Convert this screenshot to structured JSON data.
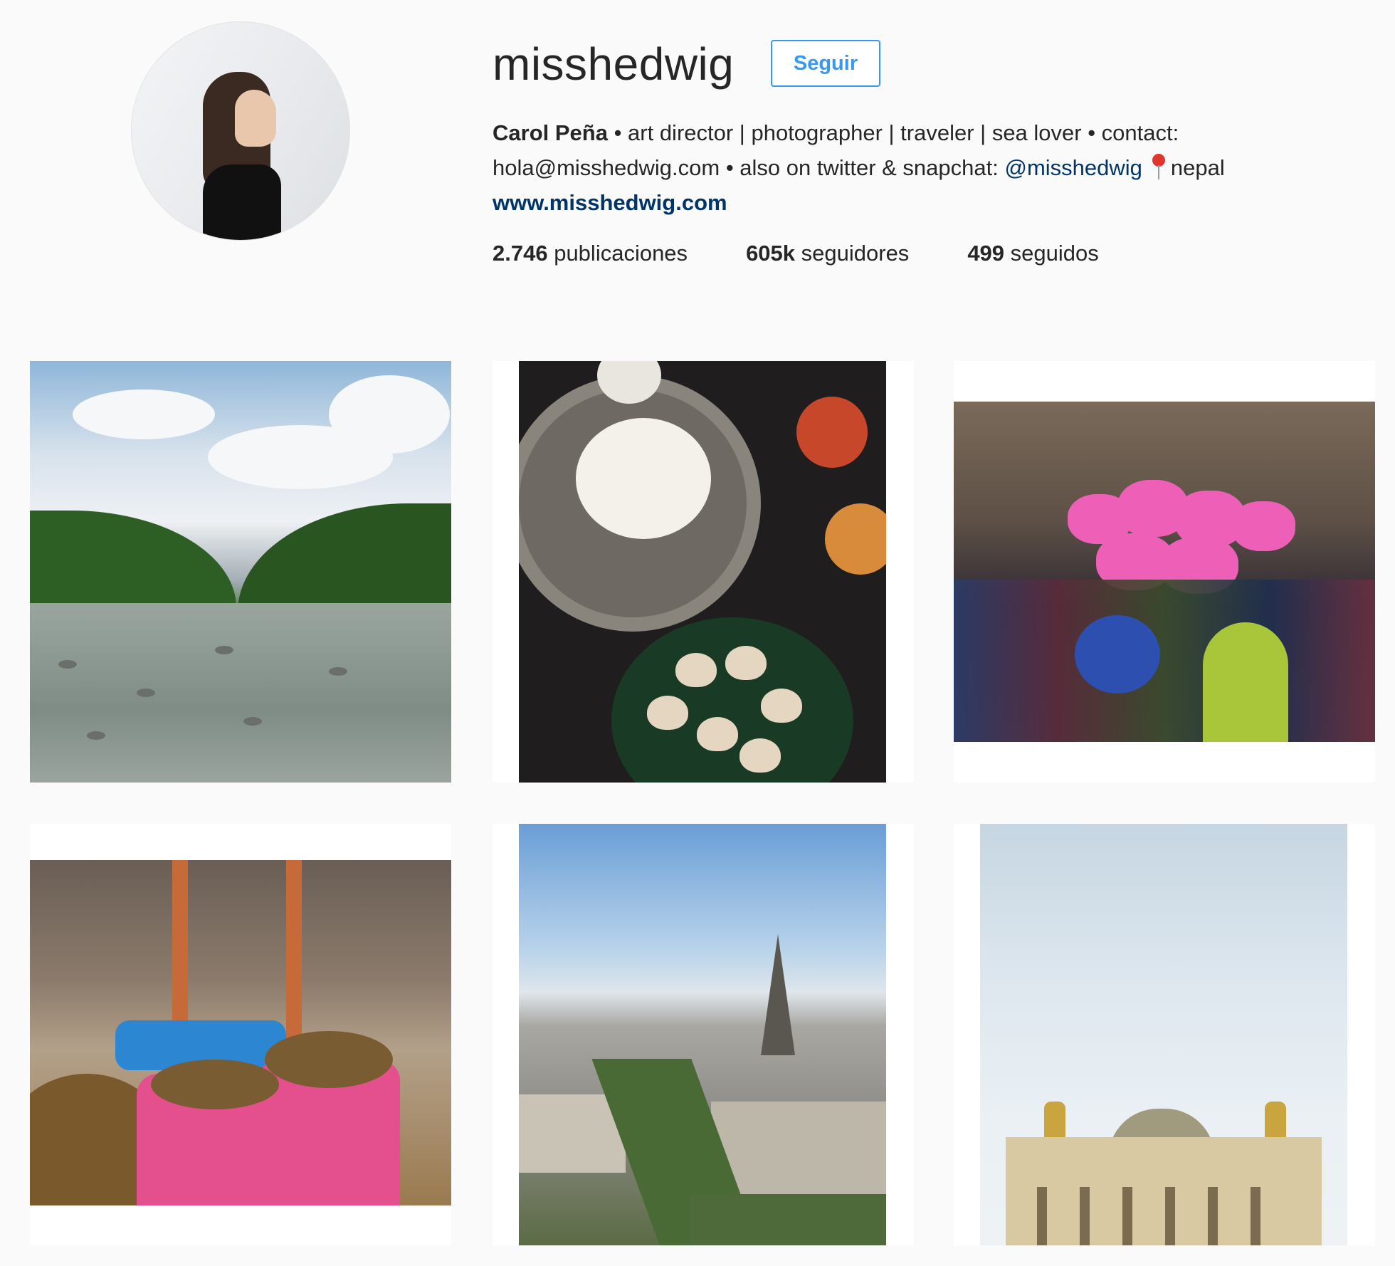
{
  "profile": {
    "username": "misshedwig",
    "follow_label": "Seguir",
    "name": "Carol Peña",
    "bio_line1_rest": " • art director | photographer | traveler | sea lover • contact:",
    "bio_line2_start": "hola@misshedwig.com • also on twitter & snapchat: ",
    "bio_mention": "@misshedwig",
    "bio_location": "nepal",
    "website": "www.misshedwig.com"
  },
  "stats": [
    {
      "value": "2.746",
      "label": "publicaciones"
    },
    {
      "value": "605k",
      "label": "seguidores"
    },
    {
      "value": "499",
      "label": "seguidos"
    }
  ],
  "icons": {
    "location": "location-pin-icon"
  },
  "colors": {
    "accent": "#3897f0",
    "link": "#003569",
    "background": "#fafafa"
  }
}
